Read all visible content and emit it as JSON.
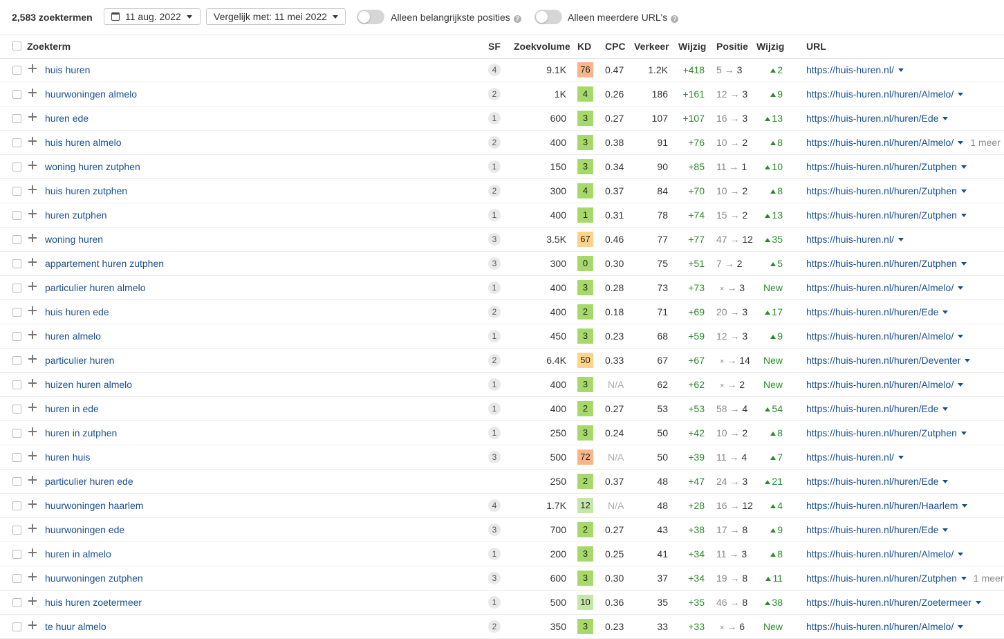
{
  "toolbar": {
    "count": "2,583 zoektermen",
    "date": "11 aug. 2022",
    "compare": "Vergelijk met: 11 mei 2022",
    "toggle1": "Alleen belangrijkste posities",
    "toggle2": "Alleen meerdere URL's"
  },
  "columns": {
    "keyword": "Zoekterm",
    "sf": "SF",
    "volume": "Zoekvolume",
    "kd": "KD",
    "cpc": "CPC",
    "traffic": "Verkeer",
    "change": "Wijzig",
    "position": "Positie",
    "poschange": "Wijzig",
    "url": "URL"
  },
  "colors": {
    "kd_green": "#a6d96a",
    "kd_lightgreen": "#c6e6a8",
    "kd_orange": "#f8b58a",
    "kd_yellow": "#fbd38a",
    "link": "#1a4f8b",
    "up": "#2a8a2a"
  },
  "rows": [
    {
      "kw": "huis huren",
      "sf": "4",
      "vol": "9.1K",
      "kd": "76",
      "cpc": "0.47",
      "traffic": "1.2K",
      "chg": "+418",
      "pfrom": "5",
      "pto": "3",
      "pchg": "2",
      "url": "https://huis-huren.nl/",
      "more": ""
    },
    {
      "kw": "huurwoningen almelo",
      "sf": "2",
      "vol": "1K",
      "kd": "4",
      "cpc": "0.26",
      "traffic": "186",
      "chg": "+161",
      "pfrom": "12",
      "pto": "3",
      "pchg": "9",
      "url": "https://huis-huren.nl/huren/Almelo/",
      "more": ""
    },
    {
      "kw": "huren ede",
      "sf": "1",
      "vol": "600",
      "kd": "3",
      "cpc": "0.27",
      "traffic": "107",
      "chg": "+107",
      "pfrom": "16",
      "pto": "3",
      "pchg": "13",
      "url": "https://huis-huren.nl/huren/Ede",
      "more": ""
    },
    {
      "kw": "huis huren almelo",
      "sf": "2",
      "vol": "400",
      "kd": "3",
      "cpc": "0.38",
      "traffic": "91",
      "chg": "+76",
      "pfrom": "10",
      "pto": "2",
      "pchg": "8",
      "url": "https://huis-huren.nl/huren/Almelo/",
      "more": "1 meer"
    },
    {
      "kw": "woning huren zutphen",
      "sf": "1",
      "vol": "150",
      "kd": "3",
      "cpc": "0.34",
      "traffic": "90",
      "chg": "+85",
      "pfrom": "11",
      "pto": "1",
      "pchg": "10",
      "url": "https://huis-huren.nl/huren/Zutphen",
      "more": ""
    },
    {
      "kw": "huis huren zutphen",
      "sf": "2",
      "vol": "300",
      "kd": "4",
      "cpc": "0.37",
      "traffic": "84",
      "chg": "+70",
      "pfrom": "10",
      "pto": "2",
      "pchg": "8",
      "url": "https://huis-huren.nl/huren/Zutphen",
      "more": ""
    },
    {
      "kw": "huren zutphen",
      "sf": "1",
      "vol": "400",
      "kd": "1",
      "cpc": "0.31",
      "traffic": "78",
      "chg": "+74",
      "pfrom": "15",
      "pto": "2",
      "pchg": "13",
      "url": "https://huis-huren.nl/huren/Zutphen",
      "more": ""
    },
    {
      "kw": "woning huren",
      "sf": "3",
      "vol": "3.5K",
      "kd": "67",
      "cpc": "0.46",
      "traffic": "77",
      "chg": "+77",
      "pfrom": "47",
      "pto": "12",
      "pchg": "35",
      "url": "https://huis-huren.nl/",
      "more": ""
    },
    {
      "kw": "appartement huren zutphen",
      "sf": "3",
      "vol": "300",
      "kd": "0",
      "cpc": "0.30",
      "traffic": "75",
      "chg": "+51",
      "pfrom": "7",
      "pto": "2",
      "pchg": "5",
      "url": "https://huis-huren.nl/huren/Zutphen",
      "more": ""
    },
    {
      "kw": "particulier huren almelo",
      "sf": "1",
      "vol": "400",
      "kd": "3",
      "cpc": "0.28",
      "traffic": "73",
      "chg": "+73",
      "pfrom": "×",
      "pto": "3",
      "pchg": "New",
      "url": "https://huis-huren.nl/huren/Almelo/",
      "more": ""
    },
    {
      "kw": "huis huren ede",
      "sf": "2",
      "vol": "400",
      "kd": "2",
      "cpc": "0.18",
      "traffic": "71",
      "chg": "+69",
      "pfrom": "20",
      "pto": "3",
      "pchg": "17",
      "url": "https://huis-huren.nl/huren/Ede",
      "more": ""
    },
    {
      "kw": "huren almelo",
      "sf": "1",
      "vol": "450",
      "kd": "3",
      "cpc": "0.23",
      "traffic": "68",
      "chg": "+59",
      "pfrom": "12",
      "pto": "3",
      "pchg": "9",
      "url": "https://huis-huren.nl/huren/Almelo/",
      "more": ""
    },
    {
      "kw": "particulier huren",
      "sf": "2",
      "vol": "6.4K",
      "kd": "50",
      "cpc": "0.33",
      "traffic": "67",
      "chg": "+67",
      "pfrom": "×",
      "pto": "14",
      "pchg": "New",
      "url": "https://huis-huren.nl/huren/Deventer",
      "more": ""
    },
    {
      "kw": "huizen huren almelo",
      "sf": "1",
      "vol": "400",
      "kd": "3",
      "cpc": "N/A",
      "traffic": "62",
      "chg": "+62",
      "pfrom": "×",
      "pto": "2",
      "pchg": "New",
      "url": "https://huis-huren.nl/huren/Almelo/",
      "more": ""
    },
    {
      "kw": "huren in ede",
      "sf": "1",
      "vol": "400",
      "kd": "2",
      "cpc": "0.27",
      "traffic": "53",
      "chg": "+53",
      "pfrom": "58",
      "pto": "4",
      "pchg": "54",
      "url": "https://huis-huren.nl/huren/Ede",
      "more": ""
    },
    {
      "kw": "huren in zutphen",
      "sf": "1",
      "vol": "250",
      "kd": "3",
      "cpc": "0.24",
      "traffic": "50",
      "chg": "+42",
      "pfrom": "10",
      "pto": "2",
      "pchg": "8",
      "url": "https://huis-huren.nl/huren/Zutphen",
      "more": ""
    },
    {
      "kw": "huren huis",
      "sf": "3",
      "vol": "500",
      "kd": "72",
      "cpc": "N/A",
      "traffic": "50",
      "chg": "+39",
      "pfrom": "11",
      "pto": "4",
      "pchg": "7",
      "url": "https://huis-huren.nl/",
      "more": ""
    },
    {
      "kw": "particulier huren ede",
      "sf": "",
      "vol": "250",
      "kd": "2",
      "cpc": "0.37",
      "traffic": "48",
      "chg": "+47",
      "pfrom": "24",
      "pto": "3",
      "pchg": "21",
      "url": "https://huis-huren.nl/huren/Ede",
      "more": ""
    },
    {
      "kw": "huurwoningen haarlem",
      "sf": "4",
      "vol": "1.7K",
      "kd": "12",
      "cpc": "N/A",
      "traffic": "48",
      "chg": "+28",
      "pfrom": "16",
      "pto": "12",
      "pchg": "4",
      "url": "https://huis-huren.nl/huren/Haarlem",
      "more": ""
    },
    {
      "kw": "huurwoningen ede",
      "sf": "3",
      "vol": "700",
      "kd": "2",
      "cpc": "0.27",
      "traffic": "43",
      "chg": "+38",
      "pfrom": "17",
      "pto": "8",
      "pchg": "9",
      "url": "https://huis-huren.nl/huren/Ede",
      "more": ""
    },
    {
      "kw": "huren in almelo",
      "sf": "1",
      "vol": "200",
      "kd": "3",
      "cpc": "0.25",
      "traffic": "41",
      "chg": "+34",
      "pfrom": "11",
      "pto": "3",
      "pchg": "8",
      "url": "https://huis-huren.nl/huren/Almelo/",
      "more": ""
    },
    {
      "kw": "huurwoningen zutphen",
      "sf": "3",
      "vol": "600",
      "kd": "3",
      "cpc": "0.30",
      "traffic": "37",
      "chg": "+34",
      "pfrom": "19",
      "pto": "8",
      "pchg": "11",
      "url": "https://huis-huren.nl/huren/Zutphen",
      "more": "1 meer"
    },
    {
      "kw": "huis huren zoetermeer",
      "sf": "1",
      "vol": "500",
      "kd": "10",
      "cpc": "0.36",
      "traffic": "35",
      "chg": "+35",
      "pfrom": "46",
      "pto": "8",
      "pchg": "38",
      "url": "https://huis-huren.nl/huren/Zoetermeer",
      "more": ""
    },
    {
      "kw": "te huur almelo",
      "sf": "2",
      "vol": "350",
      "kd": "3",
      "cpc": "0.23",
      "traffic": "33",
      "chg": "+33",
      "pfrom": "×",
      "pto": "6",
      "pchg": "New",
      "url": "https://huis-huren.nl/huren/Almelo/",
      "more": ""
    }
  ]
}
